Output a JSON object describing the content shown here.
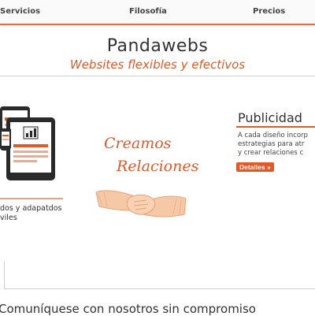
{
  "nav": {
    "items": [
      {
        "label": "Servicios"
      },
      {
        "label": "Filosofía"
      },
      {
        "label": "Precios"
      }
    ]
  },
  "header": {
    "brand": "Pandawebs",
    "tagline": "Websites flexibles y efectivos"
  },
  "left": {
    "lines": [
      "dos y adapatdos",
      "viles"
    ]
  },
  "center": {
    "line1": "Creamos",
    "line2": "Relaciones"
  },
  "publicidad": {
    "title": "Publicidad",
    "lines": [
      "A cada diseño incorp",
      "estrategias para atr",
      "y crear relaciones c"
    ],
    "button": "Detalles »"
  },
  "footer": {
    "contact": "Comuníquese con nosotros sin compromiso"
  },
  "colors": {
    "accent": "#e05a28",
    "accent_light": "#f0a98a",
    "device_dark": "#2a2a2a"
  }
}
